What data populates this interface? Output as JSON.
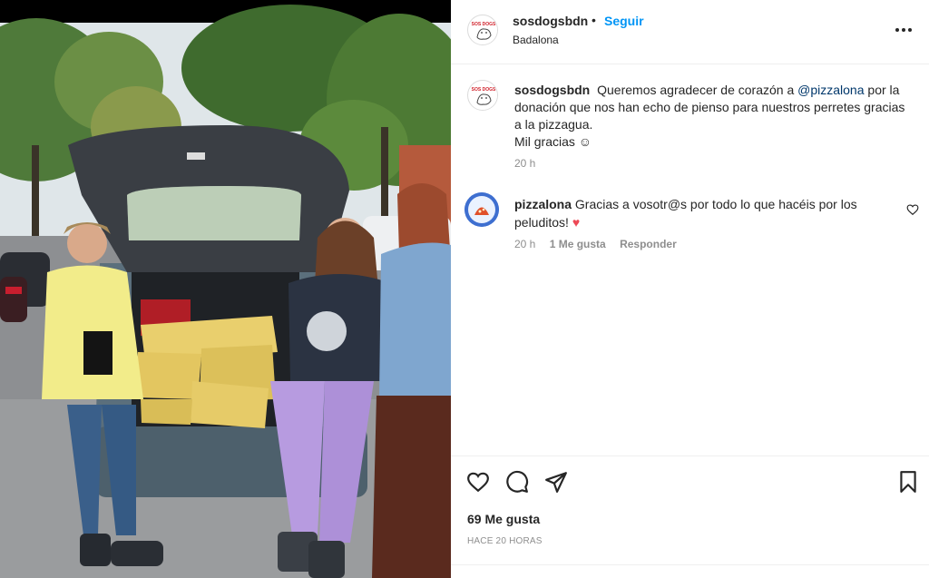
{
  "post": {
    "username": "sosdogsbdn",
    "separator": "•",
    "follow_label": "Seguir",
    "location": "Badalona",
    "more_icon": "more-options-icon",
    "avatar_text": "SOS DOGS"
  },
  "caption": {
    "username": "sosdogsbdn",
    "text_before": "Queremos agradecer de corazón a",
    "mention": "@pizzalona",
    "text_after": "por la donación que nos han echo de pienso para nuestros perretes gracias a la pizzagua.",
    "line2": "Mil gracias ☺",
    "time": "20 h"
  },
  "comment": {
    "username": "pizzalona",
    "text": "Gracias a vosotr@s por todo lo que hacéis por los peluditos!",
    "emoji": "♥",
    "time": "20 h",
    "likes": "1 Me gusta",
    "reply_label": "Responder"
  },
  "actions": {
    "icons": [
      "heart-icon",
      "comment-icon",
      "share-icon",
      "bookmark-icon"
    ],
    "likes": "69 Me gusta",
    "ago": "HACE 20 HORAS"
  },
  "colors": {
    "follow": "#0095f6",
    "mention": "#00376b",
    "heart_red": "#ed4956",
    "secondary_text": "#8e8e8e"
  }
}
